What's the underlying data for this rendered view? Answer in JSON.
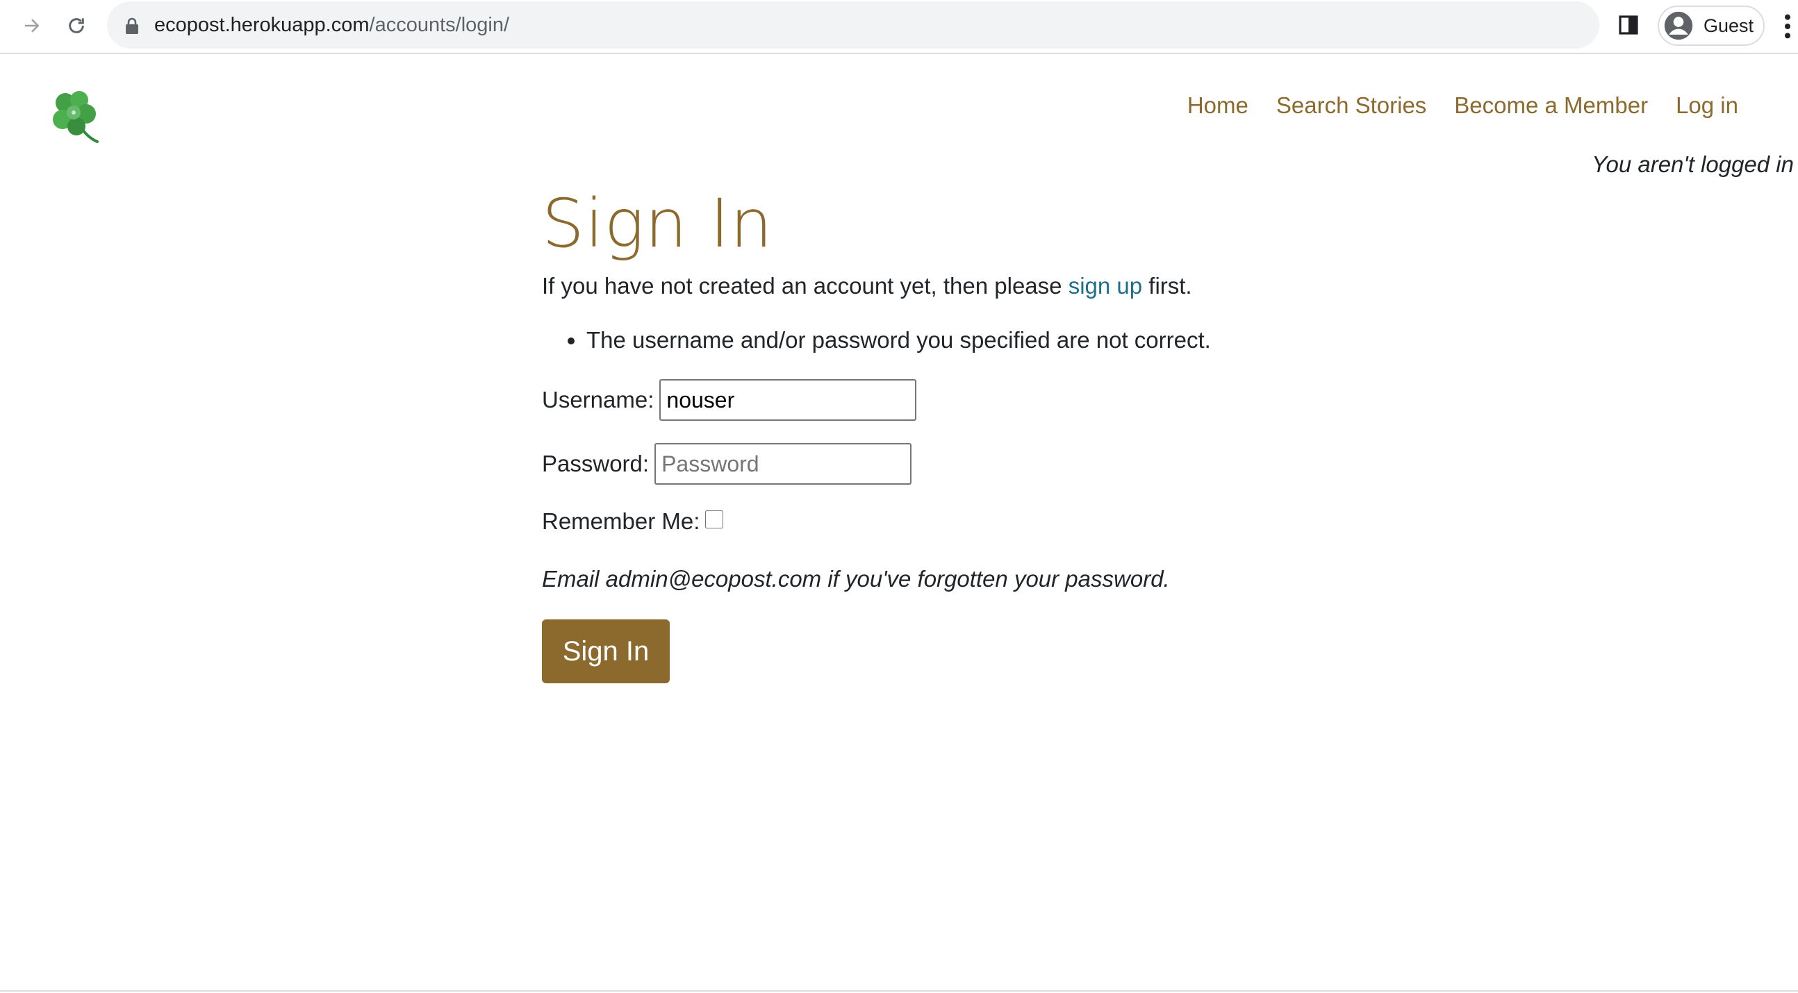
{
  "browser": {
    "url_host": "ecopost.herokuapp.com",
    "url_path": "/accounts/login/",
    "profile_label": "Guest"
  },
  "nav": {
    "items": [
      {
        "label": "Home"
      },
      {
        "label": "Search Stories"
      },
      {
        "label": "Become a Member"
      },
      {
        "label": "Log in"
      }
    ],
    "status": "You aren't logged in"
  },
  "main": {
    "title": "Sign In",
    "intro_before": "If you have not created an account yet, then please ",
    "intro_link": "sign up",
    "intro_after": " first.",
    "errors": [
      "The username and/or password you specified are not correct."
    ],
    "username_label": "Username:",
    "username_value": "nouser",
    "password_label": "Password:",
    "password_placeholder": "Password",
    "remember_label": "Remember Me:",
    "forgot_text": "Email admin@ecopost.com if you've forgotten your password.",
    "submit_label": "Sign In"
  },
  "colors": {
    "brand": "#8c6a2d",
    "link": "#1f6f8b",
    "text": "#212529"
  },
  "icons": {
    "logo": "four-leaf-clover-icon"
  }
}
